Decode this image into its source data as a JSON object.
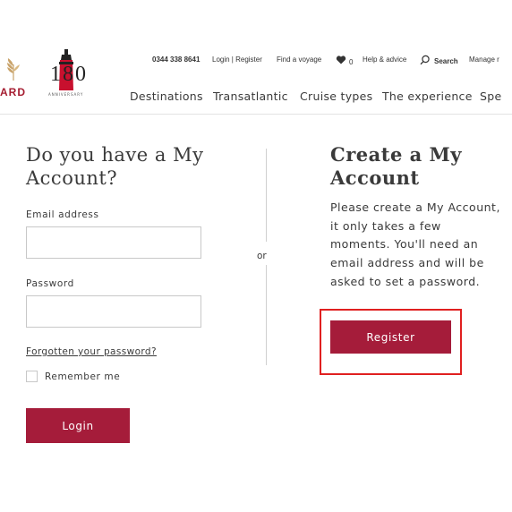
{
  "header": {
    "brand": "ARD",
    "anniversary_number": "180",
    "anniversary_subtitle": "ANNIVERSARY",
    "phone": "0344 338 8641",
    "login_register": "Login | Register",
    "find_voyage": "Find a voyage",
    "favourites_count": "0",
    "help": "Help & advice",
    "search": "Search",
    "manage": "Manage r",
    "nav": [
      "Destinations",
      "Transatlantic",
      "Cruise types",
      "The experience",
      "Spe"
    ]
  },
  "login": {
    "heading": "Do you have a My Account?",
    "email_label": "Email address",
    "email_value": "",
    "password_label": "Password",
    "password_value": "",
    "forgot_link": "Forgotten your password?",
    "remember_label": "Remember me",
    "login_button": "Login"
  },
  "divider": {
    "or_label": "or"
  },
  "register": {
    "heading": "Create a My Account",
    "description": "Please create a My Account, it only takes a few moments. You'll need an email address and will be asked to set a password.",
    "register_button": "Register"
  },
  "colors": {
    "accent": "#a51c3a",
    "highlight": "#e02020",
    "text": "#3a3a3a"
  },
  "icons": {
    "favourites": "heart-icon",
    "search": "search-icon"
  }
}
